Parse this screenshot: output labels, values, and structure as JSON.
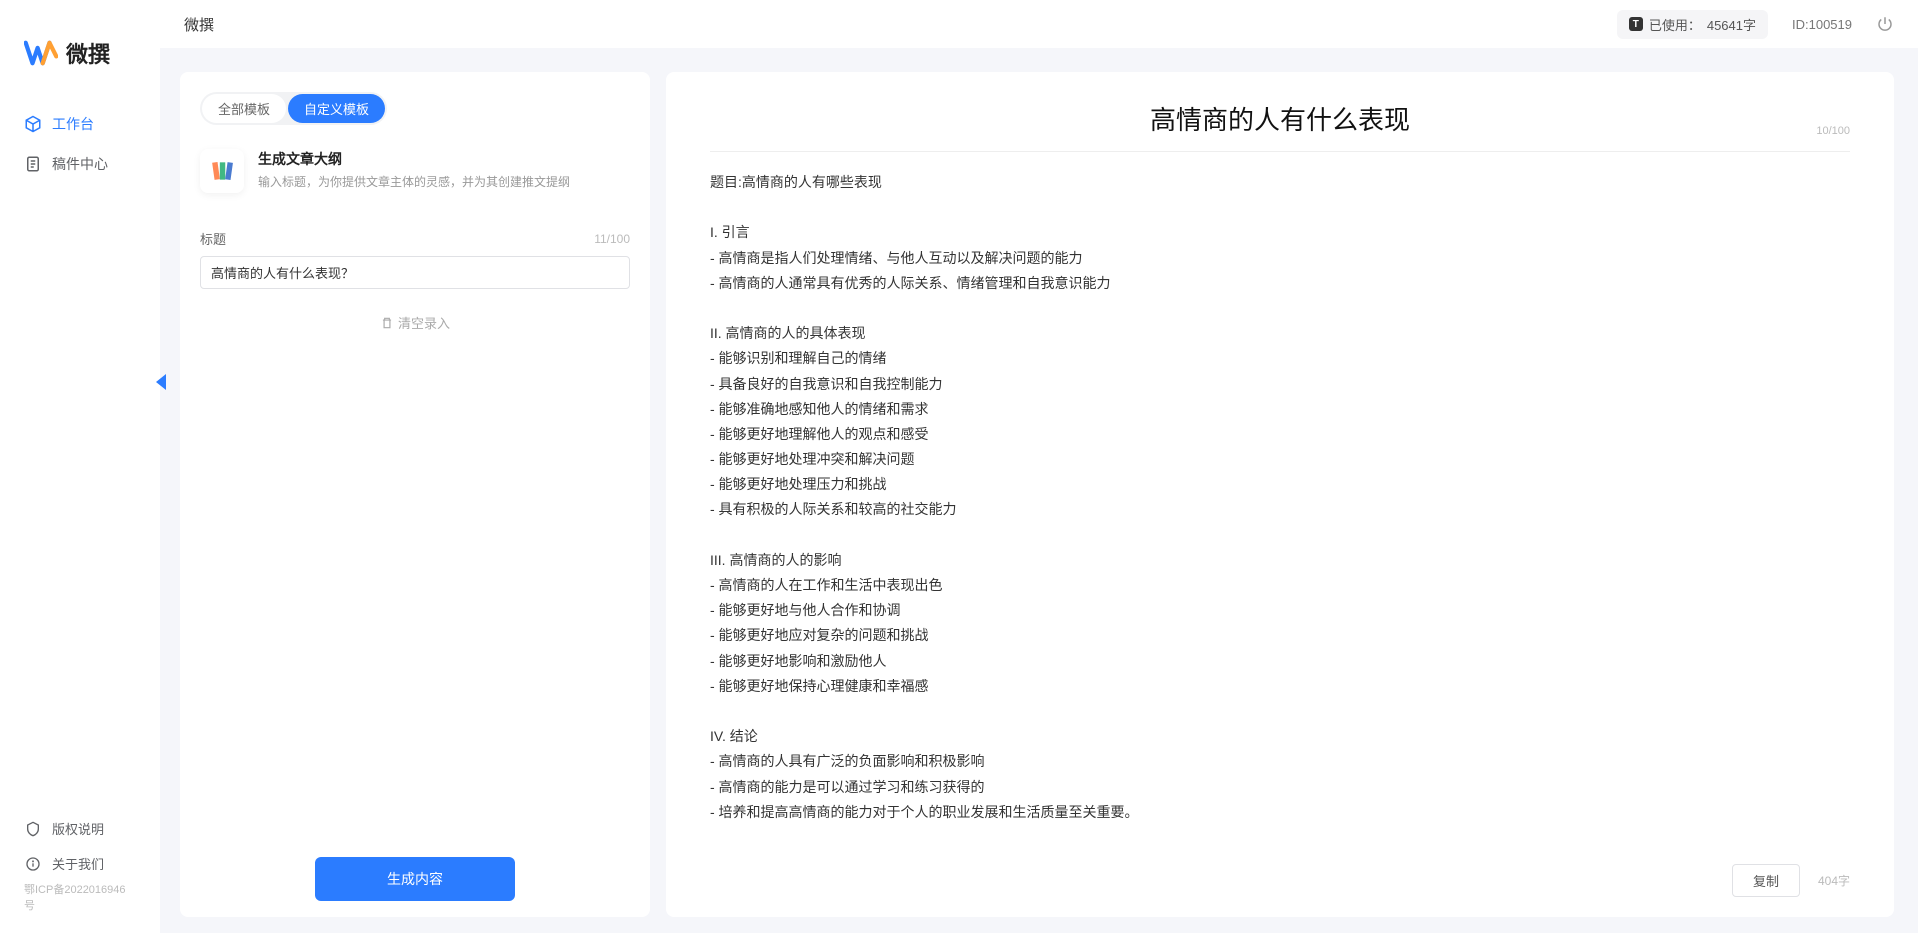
{
  "app": {
    "name": "微撰",
    "logo_text": "微撰"
  },
  "sidebar": {
    "items": [
      {
        "label": "工作台",
        "icon": "cube-icon",
        "active": true
      },
      {
        "label": "稿件中心",
        "icon": "document-icon",
        "active": false
      }
    ],
    "footer_items": [
      {
        "label": "版权说明",
        "icon": "shield-icon"
      },
      {
        "label": "关于我们",
        "icon": "info-icon"
      }
    ],
    "icp": "鄂ICP备2022016946号"
  },
  "topbar": {
    "title": "微撰",
    "usage_label": "已使用：",
    "usage_value": "45641字",
    "id_label": "ID:100519"
  },
  "left_panel": {
    "tabs": [
      {
        "label": "全部模板",
        "active": false
      },
      {
        "label": "自定义模板",
        "active": true
      }
    ],
    "template": {
      "title": "生成文章大纲",
      "desc": "输入标题，为你提供文章主体的灵感，并为其创建推文提纲"
    },
    "form": {
      "label": "标题",
      "char_count": "11/100",
      "value": "高情商的人有什么表现？"
    },
    "clear_label": "清空录入",
    "generate_label": "生成内容"
  },
  "right_panel": {
    "title": "高情商的人有什么表现",
    "title_count": "10/100",
    "body": "题目:高情商的人有哪些表现\n\nI. 引言\n- 高情商是指人们处理情绪、与他人互动以及解决问题的能力\n- 高情商的人通常具有优秀的人际关系、情绪管理和自我意识能力\n\nII. 高情商的人的具体表现\n- 能够识别和理解自己的情绪\n- 具备良好的自我意识和自我控制能力\n- 能够准确地感知他人的情绪和需求\n- 能够更好地理解他人的观点和感受\n- 能够更好地处理冲突和解决问题\n- 能够更好地处理压力和挑战\n- 具有积极的人际关系和较高的社交能力\n\nIII. 高情商的人的影响\n- 高情商的人在工作和生活中表现出色\n- 能够更好地与他人合作和协调\n- 能够更好地应对复杂的问题和挑战\n- 能够更好地影响和激励他人\n- 能够更好地保持心理健康和幸福感\n\nIV. 结论\n- 高情商的人具有广泛的负面影响和积极影响\n- 高情商的能力是可以通过学习和练习获得的\n- 培养和提高高情商的能力对于个人的职业发展和生活质量至关重要。",
    "copy_label": "复制",
    "word_count": "404字"
  }
}
